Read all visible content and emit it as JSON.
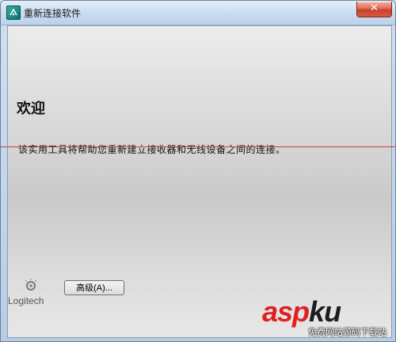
{
  "window": {
    "title": "重新连接软件",
    "close_glyph": "✕"
  },
  "main": {
    "heading": "欢迎",
    "description": "该实用工具将帮助您重新建立接收器和无线设备之间的连接。"
  },
  "footer": {
    "logo_text": "Logitech",
    "advanced_button": "高级(A)..."
  },
  "watermark": {
    "brand_red": "asp",
    "brand_dark": "ku",
    "sub": "免费网站源码下载站"
  },
  "colors": {
    "accent_line": "#d43a3a",
    "close": "#c7402b",
    "brand_red": "#e02020"
  }
}
